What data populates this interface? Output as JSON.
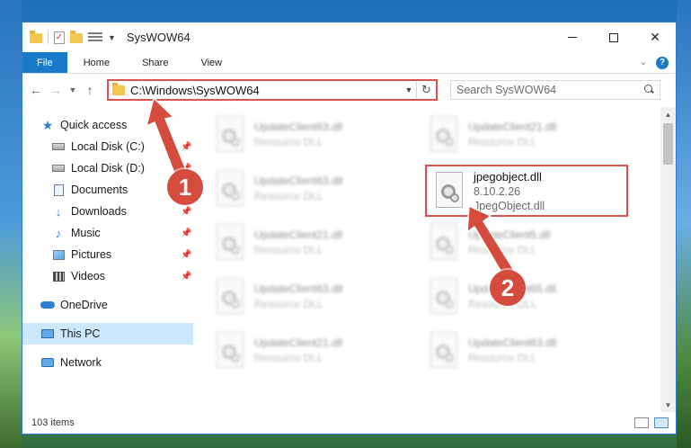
{
  "window": {
    "title": "SysWOW64",
    "minimize_glyph": "—",
    "close_glyph": "✕"
  },
  "ribbon": {
    "tabs": [
      "File",
      "Home",
      "Share",
      "View"
    ],
    "help": "?"
  },
  "address": {
    "path": "C:\\Windows\\SysWOW64",
    "search_placeholder": "Search SysWOW64"
  },
  "nav": {
    "quick_access": "Quick access",
    "items": [
      {
        "label": "Local Disk (C:)",
        "icon": "drive-icon",
        "pinned": true
      },
      {
        "label": "Local Disk (D:)",
        "icon": "drive-icon",
        "pinned": true
      },
      {
        "label": "Documents",
        "icon": "documents-icon",
        "pinned": true
      },
      {
        "label": "Downloads",
        "icon": "downloads-icon",
        "pinned": true
      },
      {
        "label": "Music",
        "icon": "music-icon",
        "pinned": true
      },
      {
        "label": "Pictures",
        "icon": "pictures-icon",
        "pinned": true
      },
      {
        "label": "Videos",
        "icon": "videos-icon",
        "pinned": true
      }
    ],
    "onedrive": "OneDrive",
    "this_pc": "This PC",
    "network": "Network"
  },
  "files": [
    {
      "name": "UpdateClient63.dll",
      "type": "Resource DLL"
    },
    {
      "name": "UpdateClient21.dll",
      "type": "Resource DLL"
    },
    {
      "name": "UpdateClient63.dll",
      "type": "Resource DLL"
    },
    {
      "name": "UpdateClient21.dll",
      "type": "Resource DLL"
    },
    {
      "name": "UpdateClient5.dll",
      "type": "Resource DLL"
    },
    {
      "name": "UpdateClient63.dll",
      "type": "Resource DLL"
    },
    {
      "name": "UpdateClient65.dll",
      "type": "Resource DLL"
    },
    {
      "name": "UpdateClient21.dll",
      "type": "Resource DLL"
    },
    {
      "name": "UpdateClient63.dll",
      "type": "Resource DLL"
    }
  ],
  "highlighted_file": {
    "name": "jpegobject.dll",
    "version": "8.10.2.26",
    "description": "JpegObject.dll"
  },
  "status": {
    "count": "103 items"
  },
  "annotations": {
    "badge_1": "1",
    "badge_2": "2",
    "color": "#d54b3e"
  }
}
